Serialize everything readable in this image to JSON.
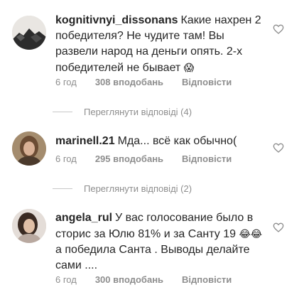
{
  "comments": [
    {
      "username": "kognitivnyi_dissonans",
      "text": "Какие нахрен 2 победителя? Не чудите там! Вы развели народ на деньги опять. 2-х победителей не бывает",
      "emoji": "😱",
      "time": "6 год",
      "likes": "308 вподобань",
      "reply_label": "Відповісти",
      "view_replies": "Переглянути відповіді (4)",
      "avatar_icon": "landscape-avatar-icon"
    },
    {
      "username": "marinell.21",
      "text": "Мда... всё как обычно(",
      "time": "6 год",
      "likes": "295 вподобань",
      "reply_label": "Відповісти",
      "view_replies": "Переглянути відповіді (2)",
      "avatar_icon": "person-avatar-icon"
    },
    {
      "username": "angela_rul",
      "text_before_emoji": "У вас голосование  было в сторис за Юлю 81% и за Санту 19 ",
      "emoji": "😂😂",
      "text_after_emoji": "а победила Санта . Выводы делайте сами ....",
      "time": "6 год",
      "likes": "300 вподобань",
      "reply_label": "Відповісти",
      "avatar_icon": "person-avatar-icon"
    }
  ],
  "colors": {
    "text": "#262626",
    "meta": "#8e8e8e",
    "divider": "#c7c7c7",
    "background": "#ffffff"
  },
  "icons": {
    "like": "heart-outline-icon"
  }
}
